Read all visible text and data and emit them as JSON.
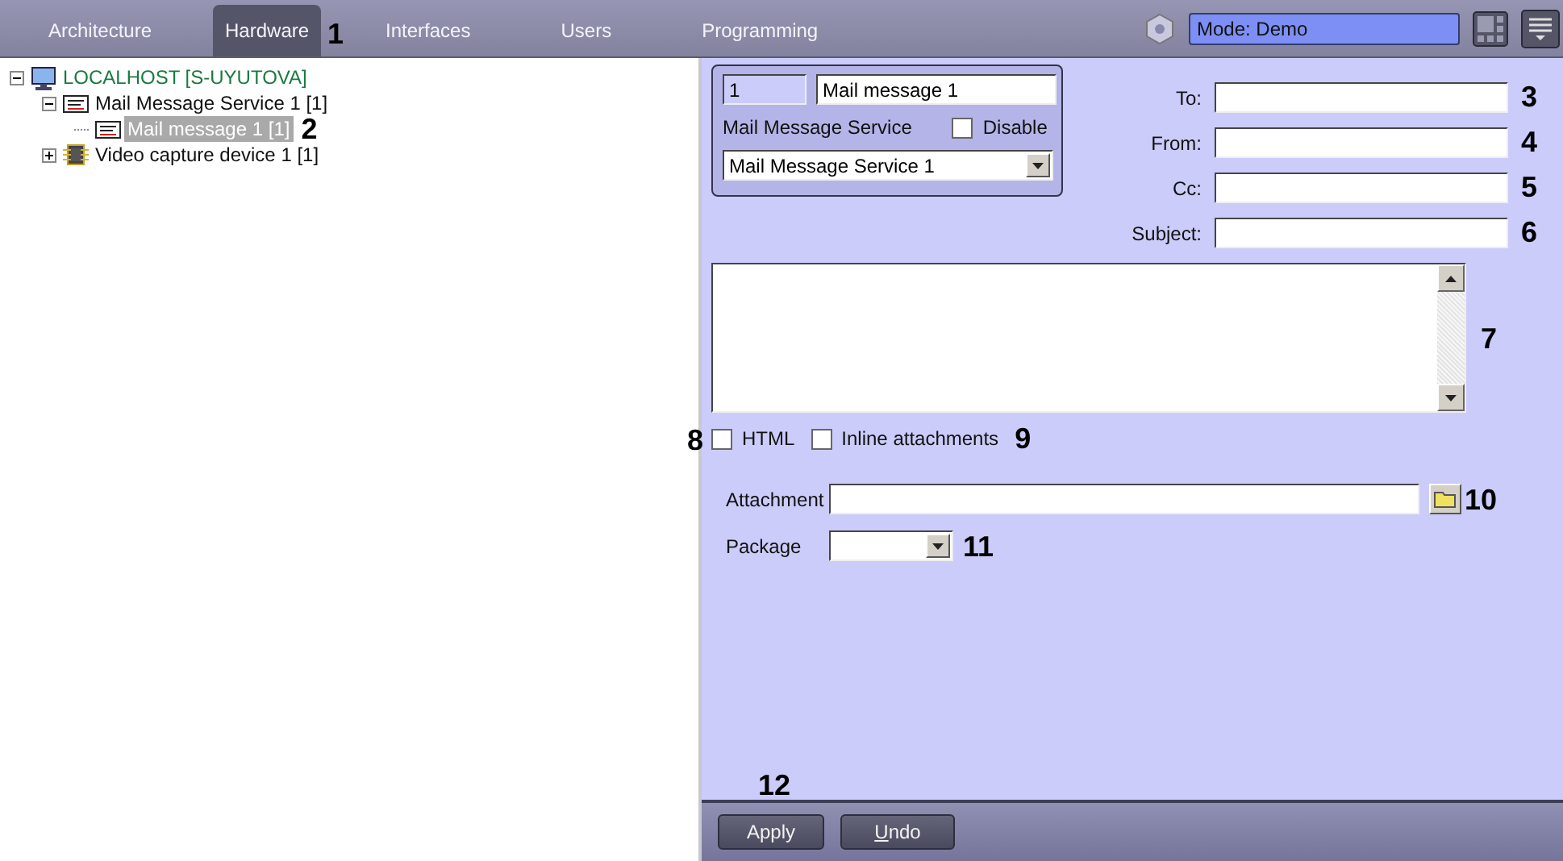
{
  "tabs": [
    {
      "label": "Architecture",
      "selected": false
    },
    {
      "label": "Hardware",
      "selected": true,
      "callout": "1"
    },
    {
      "label": "Interfaces",
      "selected": false
    },
    {
      "label": "Users",
      "selected": false
    },
    {
      "label": "Programming",
      "selected": false
    }
  ],
  "mode": {
    "value": "Mode: Demo"
  },
  "tree": [
    {
      "label": "LOCALHOST [S-UYUTOVA]",
      "kind": "computer",
      "expanded": true,
      "selected": false,
      "children": [
        {
          "label": "Mail Message Service 1 [1]",
          "kind": "mail",
          "expanded": true,
          "selected": false,
          "children": [
            {
              "label": "Mail message 1 [1]",
              "kind": "mail",
              "selected": true,
              "callout": "2"
            }
          ]
        },
        {
          "label": "Video capture device 1 [1]",
          "kind": "chip",
          "expanded": false,
          "selected": false
        }
      ]
    }
  ],
  "object_box": {
    "id": "1",
    "name": "Mail message 1",
    "type_label": "Mail Message Service",
    "disable": {
      "label": "Disable",
      "checked": false
    },
    "parent": "Mail Message Service 1"
  },
  "fields": [
    {
      "label": "To:",
      "callout": "3"
    },
    {
      "label": "From:",
      "callout": "4"
    },
    {
      "label": "Cc:",
      "callout": "5"
    },
    {
      "label": "Subject:",
      "callout": "6"
    }
  ],
  "body": {
    "callout": "7"
  },
  "options": [
    {
      "label": "HTML",
      "checked": false,
      "callout": "8"
    },
    {
      "label": "Inline attachments",
      "checked": false,
      "callout": "9"
    }
  ],
  "attachment": {
    "label": "Attachment",
    "callout": "10"
  },
  "package": {
    "label": "Package",
    "callout": "11"
  },
  "buttons": [
    {
      "label": "Apply",
      "callout": "12"
    },
    {
      "label": "Undo"
    }
  ]
}
